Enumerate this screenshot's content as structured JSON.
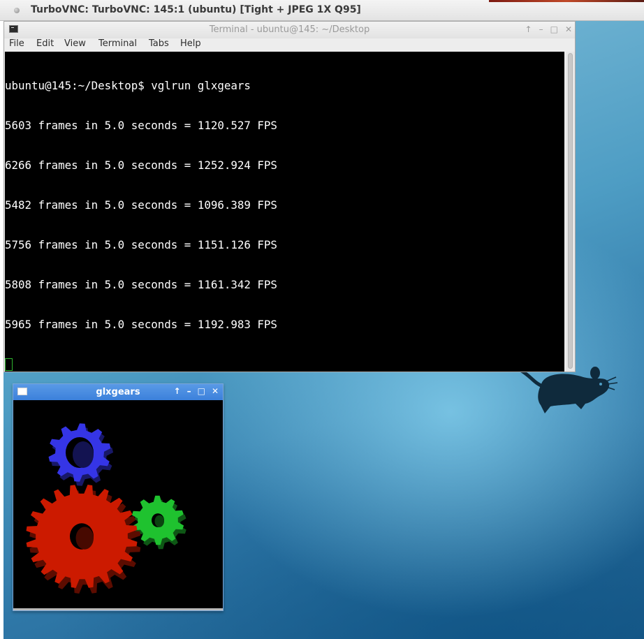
{
  "vnc": {
    "title": "TurboVNC: TurboVNC: 145:1 (ubuntu) [Tight + JPEG 1X Q95]"
  },
  "terminal": {
    "title": "Terminal - ubuntu@145: ~/Desktop",
    "controls": {
      "up": "↑",
      "minimize": "–",
      "maximize": "□",
      "close": "✕"
    },
    "menu": [
      "File",
      "Edit",
      "View",
      "Terminal",
      "Tabs",
      "Help"
    ],
    "lines": [
      "ubuntu@145:~/Desktop$ vglrun glxgears",
      "5603 frames in 5.0 seconds = 1120.527 FPS",
      "6266 frames in 5.0 seconds = 1252.924 FPS",
      "5482 frames in 5.0 seconds = 1096.389 FPS",
      "5756 frames in 5.0 seconds = 1151.126 FPS",
      "5808 frames in 5.0 seconds = 1161.342 FPS",
      "5965 frames in 5.0 seconds = 1192.983 FPS"
    ]
  },
  "glxgears": {
    "title": "glxgears",
    "controls": {
      "up": "↑",
      "minimize": "–",
      "maximize": "□",
      "close": "✕"
    },
    "gear_colors": {
      "red": "#cc1a00",
      "green": "#1fc22f",
      "blue": "#3535e6"
    }
  },
  "colors": {
    "terminal_bg": "#000000",
    "terminal_fg": "#ffffff",
    "glx_titlebar": "#3b80db"
  }
}
